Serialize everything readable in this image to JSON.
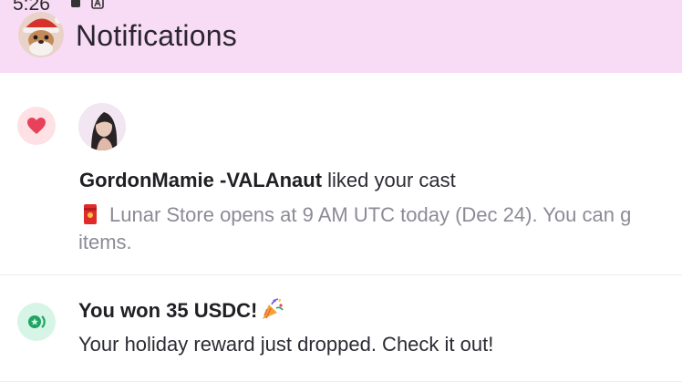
{
  "status_bar": {
    "time": "5:26"
  },
  "header": {
    "title": "Notifications"
  },
  "notifications": [
    {
      "type": "like",
      "username": "GordonMamie -VALAnaut",
      "action": " liked your cast",
      "cast_preview_line1": "Lunar Store opens at 9 AM UTC today (Dec 24). You can g",
      "cast_preview_line2": "items."
    },
    {
      "type": "reward",
      "title": "You won 35 USDC!",
      "body": "Your holiday reward just dropped. Check it out!"
    }
  ],
  "icons": {
    "like_badge": "heart-icon",
    "reward_badge": "coin-icon",
    "preview_emoji": "red-envelope-icon",
    "title_emoji": "party-popper-icon"
  },
  "colors": {
    "header_bg": "#f8dcf5",
    "like": "#e8415a",
    "reward": "#1fa463",
    "muted_text": "#8b8b96"
  }
}
